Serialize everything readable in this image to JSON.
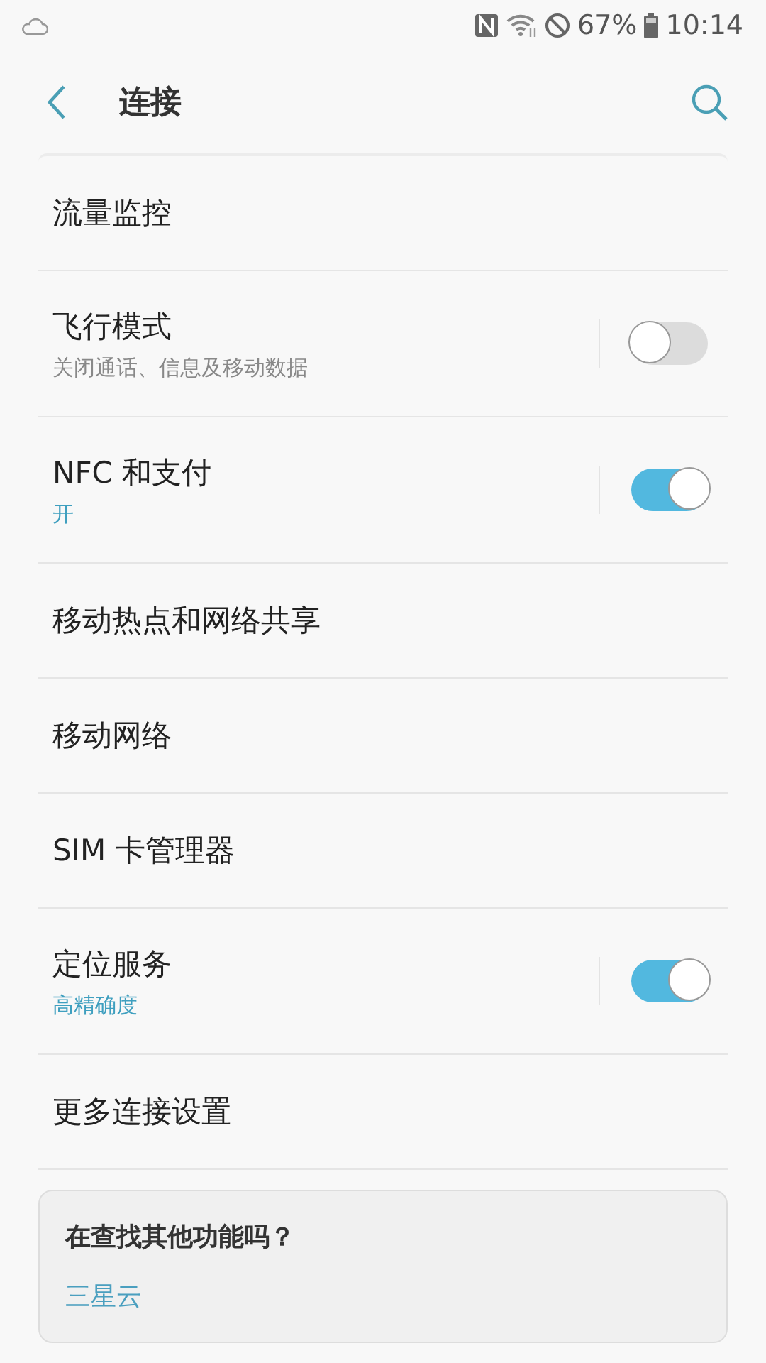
{
  "status_bar": {
    "battery": "67%",
    "time": "10:14"
  },
  "header": {
    "title": "连接"
  },
  "settings": [
    {
      "kind": "plain",
      "label": "流量监控"
    },
    {
      "kind": "toggle",
      "label": "飞行模式",
      "subtitle": "关闭通话、信息及移动数据",
      "on": false
    },
    {
      "kind": "toggle",
      "label": "NFC 和支付",
      "subtitle": "开",
      "on": true
    },
    {
      "kind": "plain",
      "label": "移动热点和网络共享"
    },
    {
      "kind": "plain",
      "label": "移动网络"
    },
    {
      "kind": "plain",
      "label": "SIM 卡管理器"
    },
    {
      "kind": "toggle",
      "label": "定位服务",
      "subtitle": "高精确度",
      "on": true
    },
    {
      "kind": "plain",
      "label": "更多连接设置"
    }
  ],
  "suggestion_card": {
    "title": "在查找其他功能吗？",
    "links": [
      "三星云"
    ]
  }
}
